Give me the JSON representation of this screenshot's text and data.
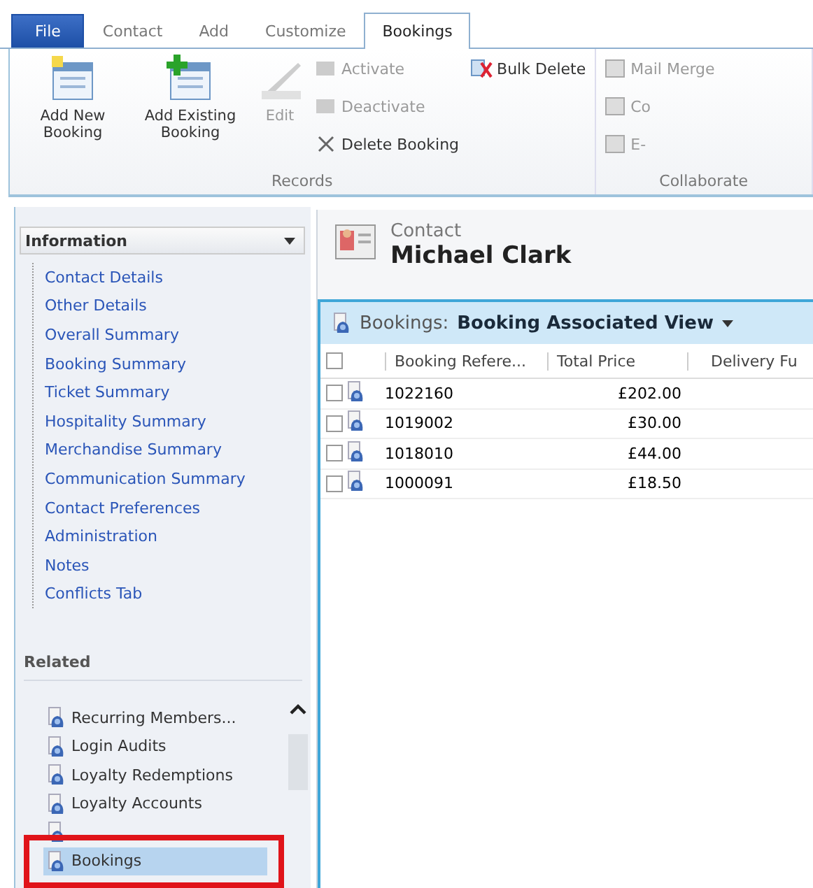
{
  "ribbon": {
    "tabs": [
      {
        "label": "File",
        "kind": "file",
        "selected": false
      },
      {
        "label": "Contact",
        "kind": "tab",
        "selected": false
      },
      {
        "label": "Add",
        "kind": "tab",
        "selected": false
      },
      {
        "label": "Customize",
        "kind": "tab",
        "selected": false
      },
      {
        "label": "Bookings",
        "kind": "tab",
        "selected": true
      }
    ],
    "groups": [
      {
        "label": "Records",
        "large_buttons": [
          {
            "label": "Add New Booking",
            "kind": "new",
            "disabled": false
          },
          {
            "label": "Add Existing Booking",
            "kind": "existing",
            "disabled": false
          },
          {
            "label": "Edit",
            "kind": "edit",
            "disabled": true
          }
        ],
        "small_buttons": [
          {
            "label": "Activate",
            "kind": "activate",
            "disabled": true
          },
          {
            "label": "Deactivate",
            "kind": "deactivate",
            "disabled": true
          },
          {
            "label": "Delete Booking",
            "kind": "delete",
            "disabled": false
          },
          {
            "label": "Bulk Delete",
            "kind": "bulk",
            "disabled": false
          }
        ]
      },
      {
        "label": "Collaborate",
        "small_buttons": [
          {
            "label": "Mail Merge",
            "kind": "merge",
            "disabled": true
          },
          {
            "label": "Co",
            "kind": "copy",
            "disabled": true
          },
          {
            "label": "E-",
            "kind": "email",
            "disabled": true
          }
        ]
      }
    ]
  },
  "navigation": {
    "information": {
      "title": "Information",
      "items": [
        "Contact Details",
        "Other Details",
        "Overall Summary",
        "Booking Summary",
        "Ticket Summary",
        "Hospitality Summary",
        "Merchandise Summary",
        "Communication Summary",
        "Contact Preferences",
        "Administration",
        "Notes",
        "Conflicts Tab"
      ]
    },
    "related": {
      "title": "Related",
      "items": [
        {
          "label": "Recurring Members...",
          "selected": false
        },
        {
          "label": "Login Audits",
          "selected": false
        },
        {
          "label": "Loyalty Redemptions",
          "selected": false
        },
        {
          "label": "Loyalty Accounts",
          "selected": false
        },
        {
          "selected": false
        },
        {
          "label": "Bookings",
          "selected": true
        }
      ]
    }
  },
  "record": {
    "entity": "Contact",
    "name": "Michael Clark"
  },
  "grid": {
    "select_all_checked": false,
    "entity": "Bookings:",
    "view": "Booking Associated View",
    "columns": [
      "Booking Refere...",
      "Total Price",
      "Delivery Fu"
    ],
    "rows": [
      {
        "reference": "1022160",
        "total_price": "£202.00",
        "checked": false
      },
      {
        "reference": "1019002",
        "total_price": "£30.00",
        "checked": false
      },
      {
        "reference": "1018010",
        "total_price": "£44.00",
        "checked": false
      },
      {
        "reference": "1000091",
        "total_price": "£18.50",
        "checked": false
      }
    ]
  }
}
